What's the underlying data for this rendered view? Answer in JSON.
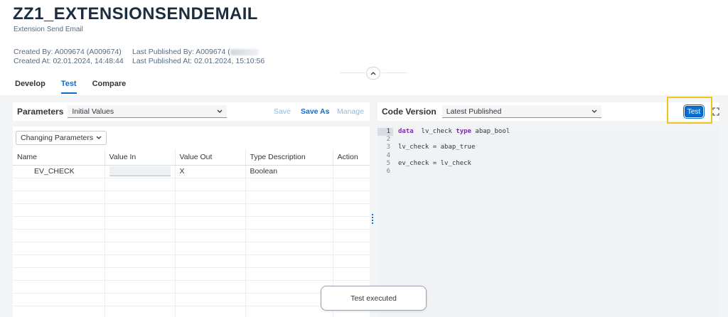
{
  "header": {
    "title": "ZZ1_EXTENSIONSENDEMAIL",
    "subtitle": "Extension Send Email",
    "created_by_label": "Created By: A009674 (A009674)",
    "created_at_label": "Created At: 02.01.2024, 14:48:44",
    "published_by_label": "Last Published By: A009674 (",
    "published_at_label": "Last Published At: 02.01.2024, 15:10:56"
  },
  "tabs": [
    {
      "label": "Develop"
    },
    {
      "label": "Test"
    },
    {
      "label": "Compare"
    }
  ],
  "parameters": {
    "label": "Parameters",
    "variant_value": "Initial Values",
    "save_label": "Save",
    "save_as_label": "Save As",
    "manage_label": "Manage",
    "type_select_value": "Changing Parameters",
    "columns": [
      "Name",
      "Value In",
      "Value Out",
      "Type Description",
      "Action"
    ],
    "rows": [
      {
        "name": "EV_CHECK",
        "value_in": "",
        "value_out": "X",
        "type_description": "Boolean",
        "action": ""
      }
    ]
  },
  "code_version": {
    "label": "Code Version",
    "value": "Latest Published",
    "test_label": "Test",
    "lines": [
      {
        "num": "1",
        "text": "data  lv_check type abap_bool"
      },
      {
        "num": "2",
        "text": ""
      },
      {
        "num": "3",
        "text": "lv_check = abap_true"
      },
      {
        "num": "4",
        "text": ""
      },
      {
        "num": "5",
        "text": "ev_check = lv_check"
      },
      {
        "num": "6",
        "text": ""
      }
    ]
  },
  "toast": {
    "message": "Test executed"
  },
  "colors": {
    "accent": "#0a6ed1",
    "highlight_box": "#f0c419",
    "keyword": "#7b2cae"
  }
}
